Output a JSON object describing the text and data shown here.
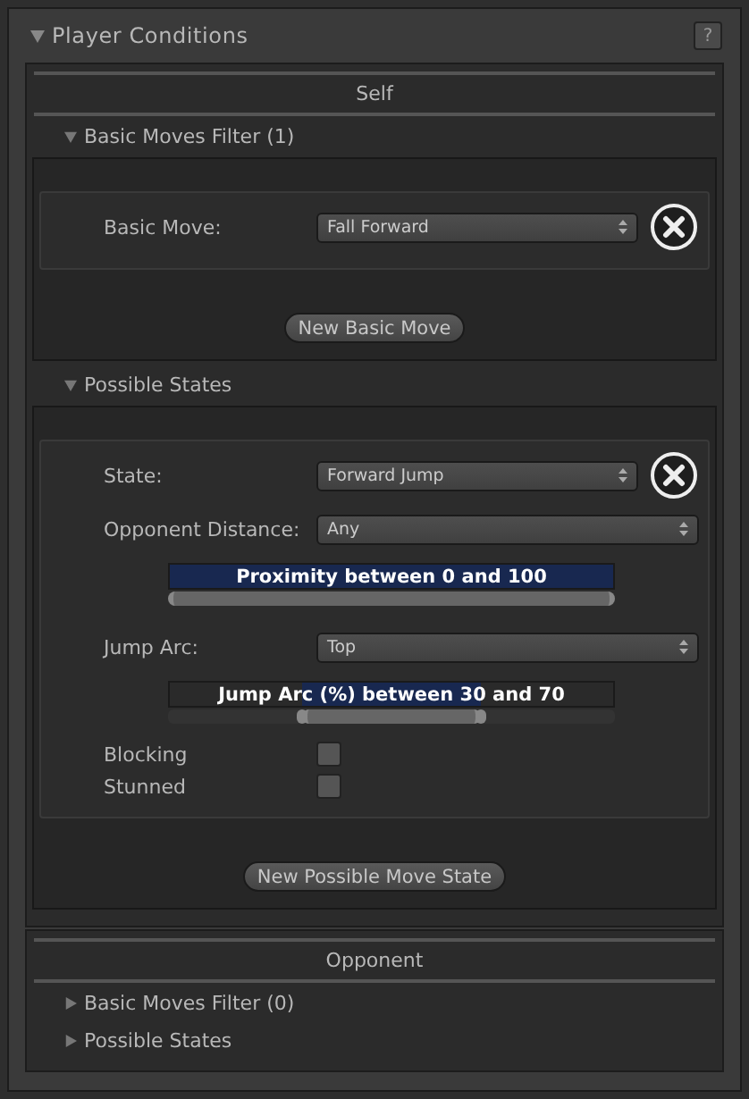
{
  "panel": {
    "title": "Player Conditions",
    "expanded": true,
    "help_button": "?"
  },
  "sections": [
    {
      "title": "Self",
      "groups": [
        {
          "label": "Basic Moves Filter (1)",
          "expanded": true,
          "entries": [
            {
              "rows": [
                {
                  "kind": "dropdown",
                  "label": "Basic Move:",
                  "value": "Fall Forward",
                  "removable": true
                }
              ]
            }
          ],
          "button": "New Basic Move"
        },
        {
          "label": "Possible States",
          "expanded": true,
          "entries": [
            {
              "rows": [
                {
                  "kind": "dropdown",
                  "label": "State:",
                  "value": "Forward Jump",
                  "removable": true
                },
                {
                  "kind": "dropdown",
                  "label": "Opponent Distance:",
                  "value": "Any",
                  "removable": false
                },
                {
                  "kind": "range",
                  "caption": "Proximity between 0 and 100"
                },
                {
                  "kind": "dropdown",
                  "label": "Jump Arc:",
                  "value": "Top",
                  "removable": false
                },
                {
                  "kind": "range",
                  "caption": "Jump Arc (%) between 30 and 70",
                  "low": {
                    "level": 0.3
                  },
                  "high": {
                    "level": 0.7
                  }
                },
                {
                  "kind": "checkbox",
                  "label": "Blocking",
                  "checked": false
                },
                {
                  "kind": "checkbox",
                  "label": "Stunned",
                  "checked": false
                }
              ]
            }
          ],
          "button": "New Possible Move State"
        }
      ]
    },
    {
      "title": "Opponent",
      "groups": [
        {
          "label": "Basic Moves Filter (0)",
          "expanded": false
        },
        {
          "label": "Possible States",
          "expanded": false
        }
      ]
    }
  ]
}
